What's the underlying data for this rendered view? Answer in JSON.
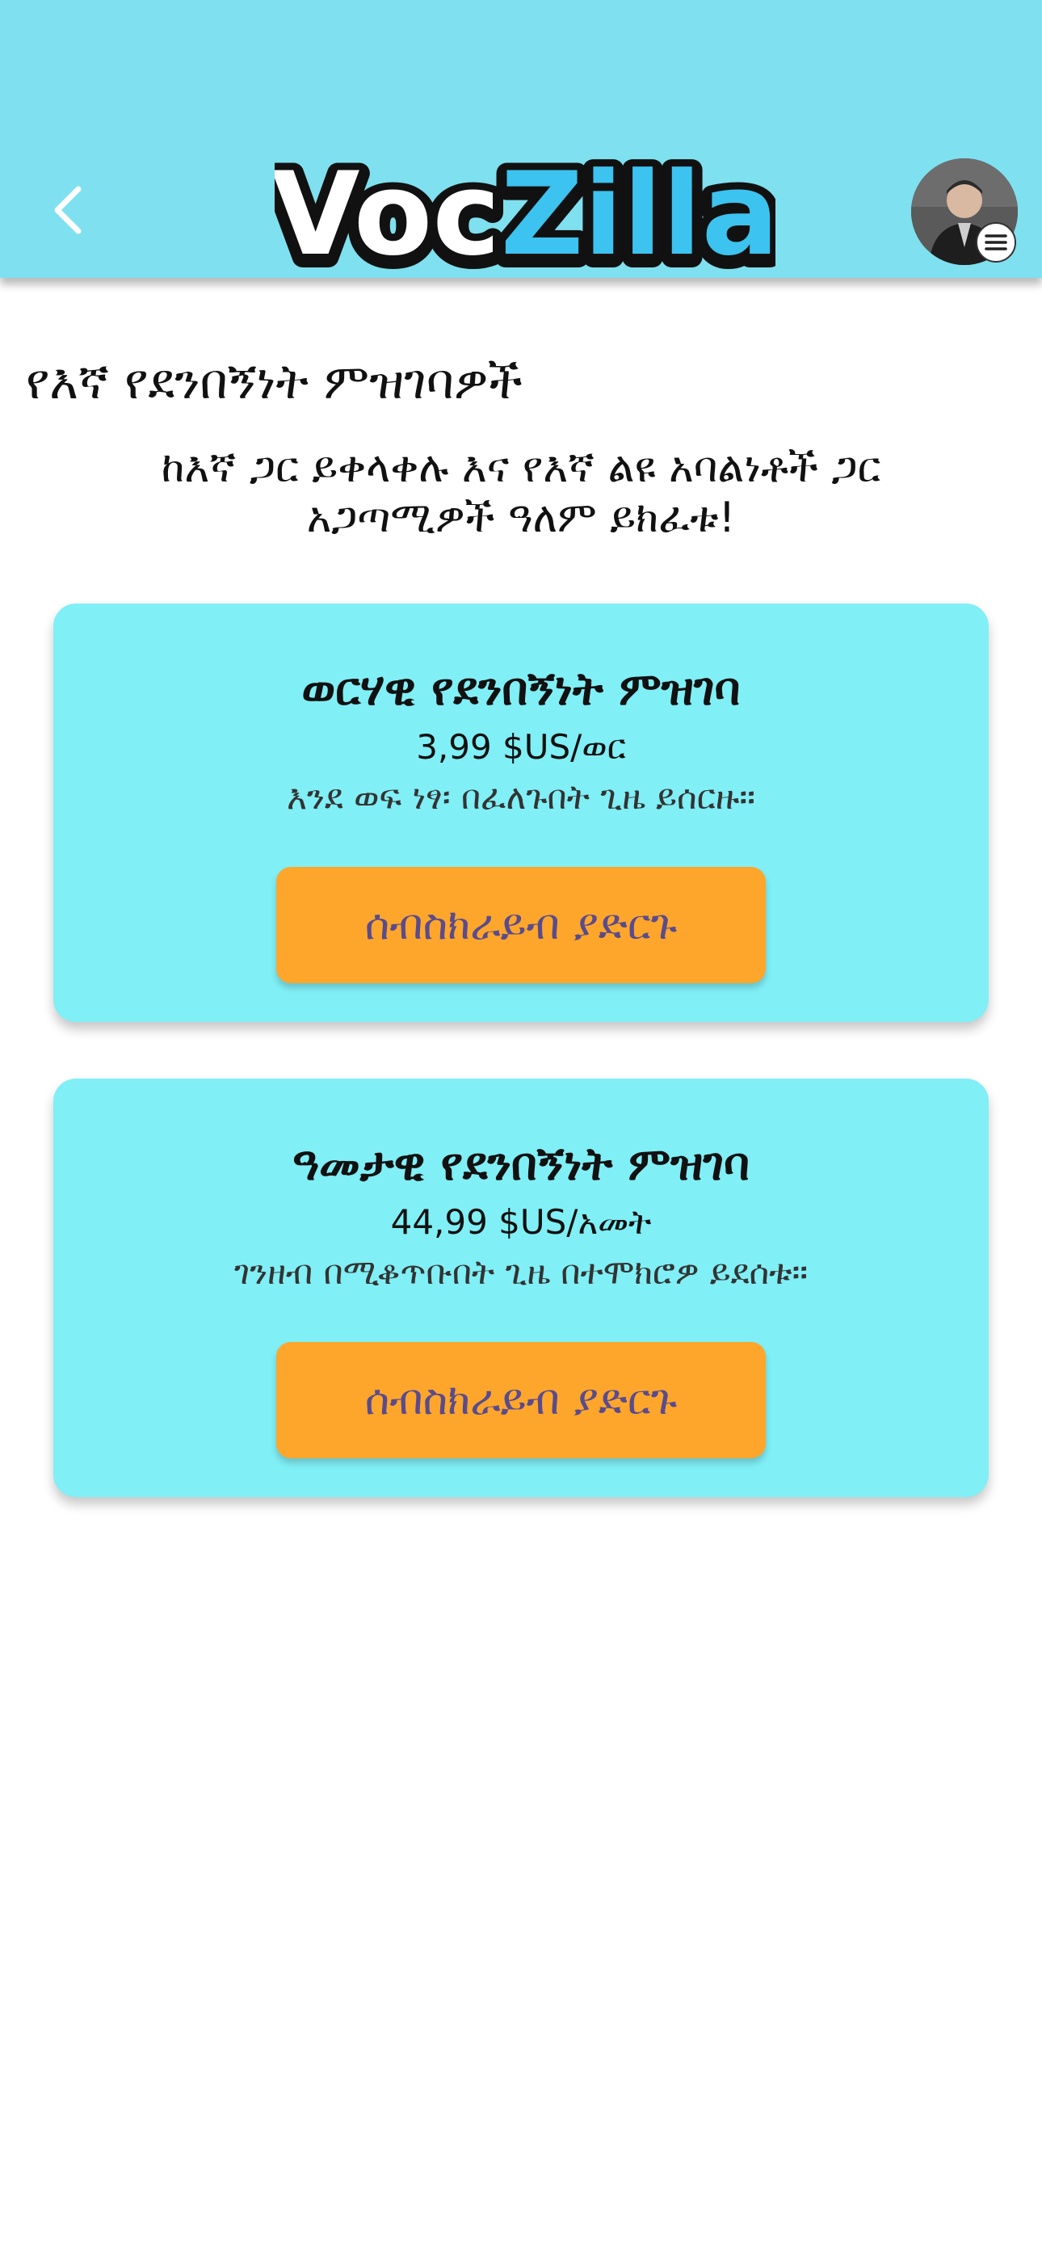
{
  "header": {
    "logo": {
      "part1": "Voc",
      "part2": "Zilla"
    },
    "back_icon": "chevron-left-icon",
    "menu_icon": "hamburger-menu-icon",
    "colors": {
      "header_bg": "#7fe0ef",
      "logo_fill_1": "#ffffff",
      "logo_fill_2": "#3cc3ef",
      "logo_outline": "#111111"
    }
  },
  "main": {
    "title": "የእኛ የደንበኝነት ምዝገባዎች",
    "subtitle_line1": "ከእኛ ጋር ይቀላቀሉ እና የእኛ ልዩ አባልነቶች ጋር",
    "subtitle_line2": "አጋጣሚዎች ዓለም ይክፈቱ!"
  },
  "plans": [
    {
      "name": "ወርሃዊ የደንበኝነት ምዝገባ",
      "price": "3,99 $US/ወር",
      "note": "እንደ ወፍ ነፃ፡ በፈለጉበት ጊዜ ይሰርዙ።",
      "button_label": "ሰብስክራይብ ያድርጉ"
    },
    {
      "name": "ዓመታዊ የደንበኝነት ምዝገባ",
      "price": "44,99 $US/አመት",
      "note": "ገንዘብ በሚቆጥቡበት ጊዜ በተሞክሮዎ ይደሰቱ።",
      "button_label": "ሰብስክራይብ ያድርጉ"
    }
  ],
  "colors": {
    "card_bg": "#80eff6",
    "button_bg": "#fda62b",
    "button_text": "#5a4b8c"
  }
}
